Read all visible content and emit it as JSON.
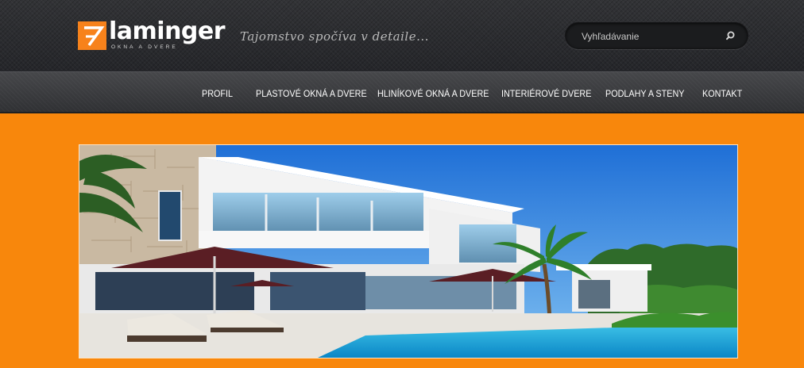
{
  "header": {
    "logo": {
      "text": "laminger",
      "subtitle": "OKNA A DVERE"
    },
    "tagline": "Tajomstvo spočíva v detaile...",
    "search": {
      "placeholder": "Vyhľadávanie",
      "value": ""
    }
  },
  "nav": {
    "items": [
      {
        "label": "PROFIL"
      },
      {
        "label": "PLASTOVÉ OKNÁ A DVERE"
      },
      {
        "label": "HLINÍKOVÉ OKNÁ A DVERE"
      },
      {
        "label": "INTERIÉROVÉ DVERE"
      },
      {
        "label": "PODLAHY A STENY"
      },
      {
        "label": "KONTAKT"
      }
    ]
  },
  "theme": {
    "brand_orange": "#f8870c",
    "header_dark": "#2b2c2f",
    "nav_text": "#ffffff"
  },
  "banner": {
    "image": "modern white villa with pool and palm trees"
  }
}
